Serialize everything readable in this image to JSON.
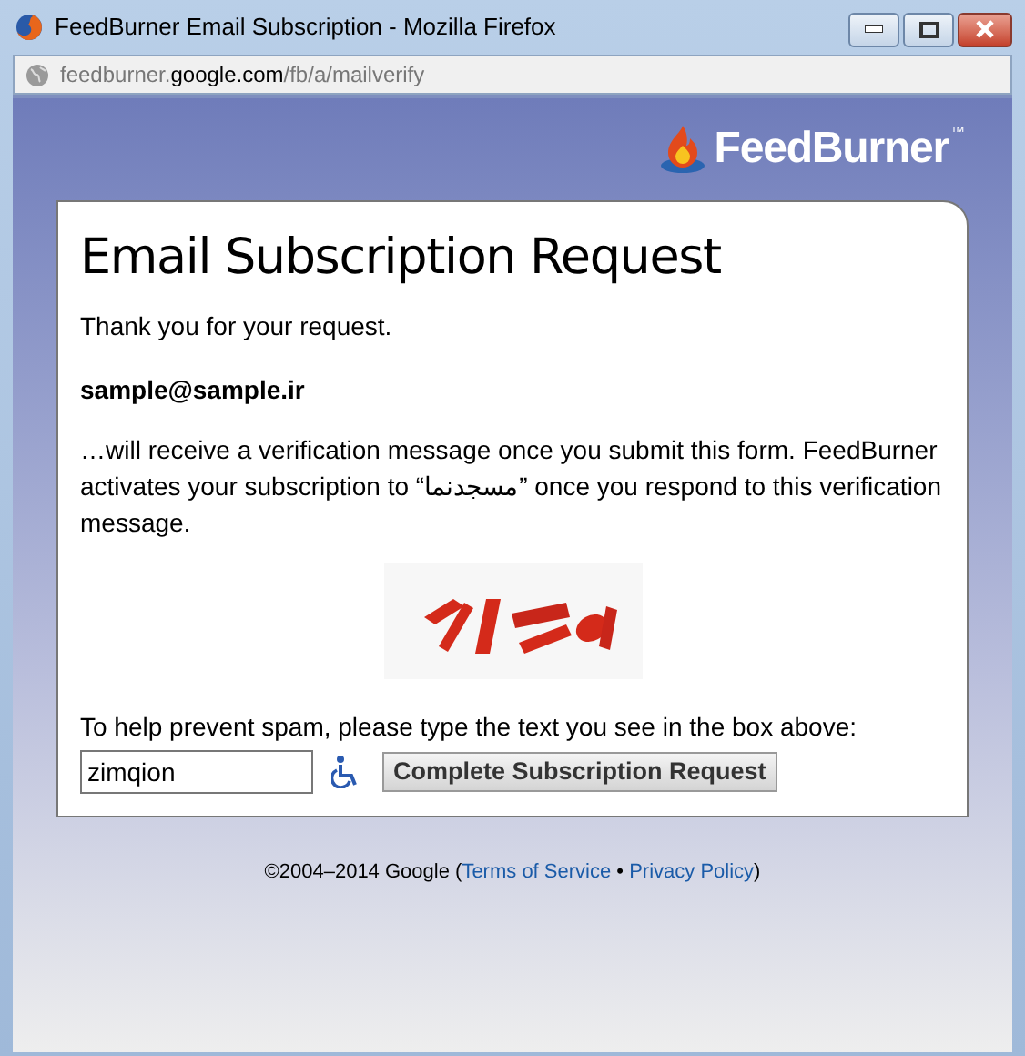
{
  "window": {
    "title": "FeedBurner Email Subscription - Mozilla Firefox"
  },
  "address_bar": {
    "prefix": "feedburner.",
    "domain": "google.com",
    "path": "/fb/a/mailverify"
  },
  "logo": {
    "text": "FeedBurner",
    "mark": "™"
  },
  "card": {
    "heading": "Email Subscription Request",
    "thanks": "Thank you for your request.",
    "email": "sample@sample.ir",
    "message": "…will receive a verification message once you submit this form. FeedBurner activates your subscription to “مسجدنما” once you respond to this verification message.",
    "prompt": "To help prevent spam, please type the text you see in the box above:",
    "answer": "zimqion",
    "submit": "Complete Subscription Request"
  },
  "footer": {
    "copyright": "©2004–2014 Google (",
    "links": [
      {
        "label": "Terms of Service"
      },
      {
        "label": "Privacy Policy"
      }
    ],
    "separator": "•",
    "close": ")"
  }
}
